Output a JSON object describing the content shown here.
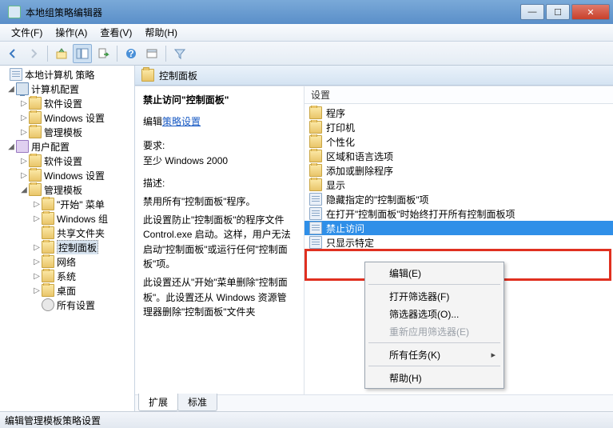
{
  "window": {
    "title": "本地组策略编辑器",
    "btn_min": "—",
    "btn_max": "☐",
    "btn_close": "✕"
  },
  "menu": {
    "file": "文件(F)",
    "action": "操作(A)",
    "view": "查看(V)",
    "help": "帮助(H)"
  },
  "tree": {
    "root": "本地计算机 策略",
    "computer_config": "计算机配置",
    "software_settings": "软件设置",
    "windows_settings": "Windows 设置",
    "admin_templates": "管理模板",
    "user_config": "用户配置",
    "start_menu": "\"开始\" 菜单",
    "windows_components": "Windows 组",
    "shared_folders": "共享文件夹",
    "control_panel": "控制面板",
    "network": "网络",
    "system": "系统",
    "desktop": "桌面",
    "all_settings": "所有设置"
  },
  "right": {
    "header": "控制面板",
    "settings_label": "设置"
  },
  "desc": {
    "title": "禁止访问\"控制面板\"",
    "edit_label": "编辑",
    "edit_link": "策略设置",
    "req_label": "要求:",
    "req_text": "至少 Windows 2000",
    "descr_label": "描述:",
    "p1": "禁用所有\"控制面板\"程序。",
    "p2": "此设置防止\"控制面板\"的程序文件 Control.exe 启动。这样，用户无法启动\"控制面板\"或运行任何\"控制面板\"项。",
    "p3": "此设置还从\"开始\"菜单删除\"控制面板\"。此设置还从 Windows 资源管理器删除\"控制面板\"文件夹"
  },
  "settings": [
    {
      "kind": "folder",
      "label": "程序"
    },
    {
      "kind": "folder",
      "label": "打印机"
    },
    {
      "kind": "folder",
      "label": "个性化"
    },
    {
      "kind": "folder",
      "label": "区域和语言选项"
    },
    {
      "kind": "folder",
      "label": "添加或删除程序"
    },
    {
      "kind": "folder",
      "label": "显示"
    },
    {
      "kind": "policy",
      "label": "隐藏指定的\"控制面板\"项"
    },
    {
      "kind": "policy",
      "label": "在打开\"控制面板\"时始终打开所有控制面板项"
    },
    {
      "kind": "policy",
      "label": "禁止访问",
      "selected": true
    },
    {
      "kind": "policy",
      "label": "只显示特定"
    }
  ],
  "ctx": {
    "edit": "编辑(E)",
    "filter_on": "打开筛选器(F)",
    "filter_options": "筛选器选项(O)...",
    "reapply_filter": "重新应用筛选器(E)",
    "all_tasks": "所有任务(K)",
    "help": "帮助(H)"
  },
  "tabs": {
    "extended": "扩展",
    "standard": "标准"
  },
  "status": "编辑管理模板策略设置"
}
